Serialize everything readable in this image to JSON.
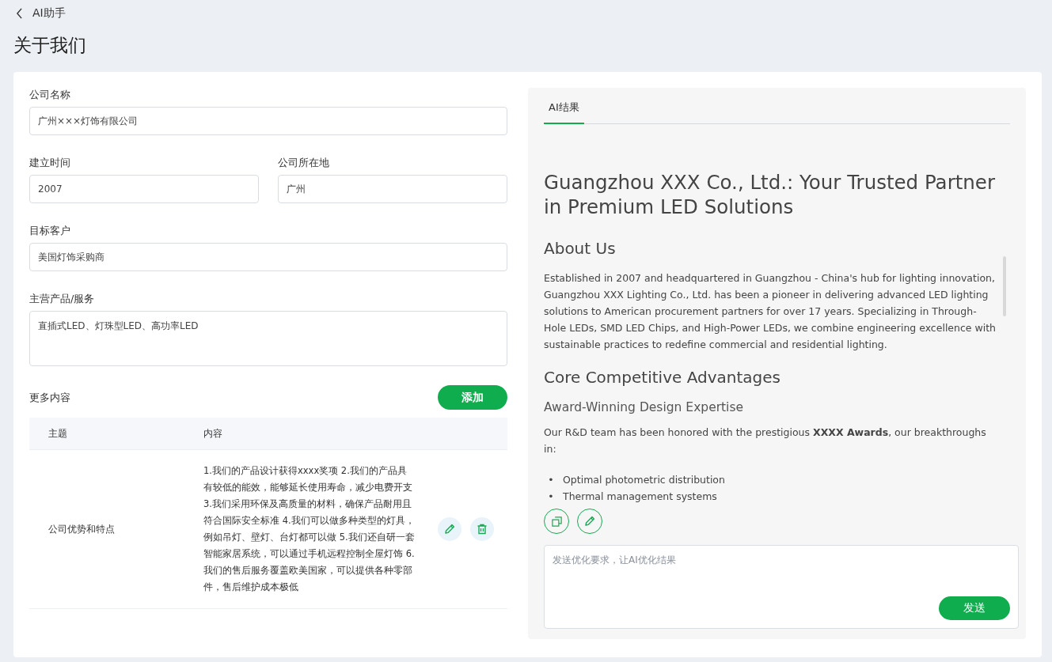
{
  "nav": {
    "back_label": "AI助手"
  },
  "page_title": "关于我们",
  "form": {
    "company_name": {
      "label": "公司名称",
      "value": "广州×××灯饰有限公司"
    },
    "founded": {
      "label": "建立时间",
      "value": "2007"
    },
    "location": {
      "label": "公司所在地",
      "value": "广州"
    },
    "target_customers": {
      "label": "目标客户",
      "value": "美国灯饰采购商"
    },
    "main_products": {
      "label": "主营产品/服务",
      "value": "直插式LED、灯珠型LED、高功率LED"
    }
  },
  "more_content": {
    "title": "更多内容",
    "add_button": "添加",
    "columns": [
      "主题",
      "内容"
    ],
    "rows": [
      {
        "topic": "公司优势和特点",
        "content": "1.我们的产品设计获得xxxx奖项 2.我们的产品具有较低的能效，能够延长使用寿命，减少电费开支 3.我们采用环保及高质量的材料，确保产品耐用且符合国际安全标准 4.我们可以做多种类型的灯具，例如吊灯、壁灯、台灯都可以做 5.我们还自研一套智能家居系统，可以通过手机远程控制全屋灯饰 6.我们的售后服务覆盖欧美国家，可以提供各种零部件，售后维护成本极低"
      }
    ]
  },
  "ai_panel": {
    "tabs": [
      {
        "label": "AI结果",
        "selected": true
      }
    ],
    "result": [
      {
        "kind": "h1",
        "text": "Guangzhou XXX Co., Ltd.: Your Trusted Partner in Premium LED Solutions"
      },
      {
        "kind": "h2",
        "text": "About Us"
      },
      {
        "kind": "p",
        "text": "Established in 2007 and headquartered in Guangzhou - China's hub for lighting innovation, Guangzhou XXX Lighting Co., Ltd. has been a pioneer in delivering advanced LED lighting solutions to American procurement partners for over 17 years. Specializing in Through-Hole LEDs, SMD LED Chips, and High-Power LEDs, we combine engineering excellence with sustainable practices to redefine commercial and residential lighting."
      },
      {
        "kind": "h2",
        "text": "Core Competitive Advantages"
      },
      {
        "kind": "h3",
        "text": "Award-Winning Design Expertise"
      },
      {
        "kind": "p",
        "text": "Our R&D team has been honored with the prestigious **XXXX Awards**, our breakthroughs in:"
      },
      {
        "kind": "list",
        "marker": "•",
        "items": [
          "Optimal photometric distribution",
          "Thermal management systems"
        ]
      }
    ],
    "prompt": {
      "placeholder": "发送优化要求，让AI优化结果"
    },
    "send_button": "发送"
  }
}
